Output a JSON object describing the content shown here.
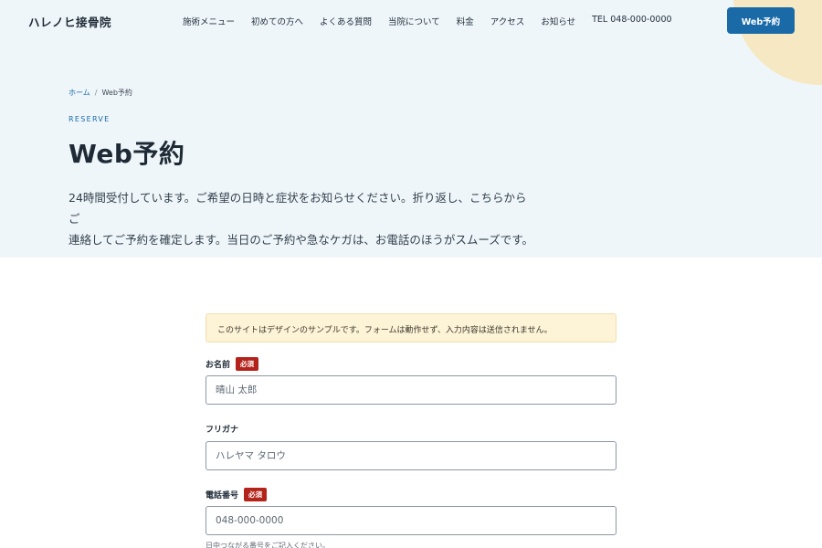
{
  "header": {
    "logo": "ハレノヒ接骨院",
    "nav": [
      {
        "label": "施術メニュー"
      },
      {
        "label": "初めての方へ"
      },
      {
        "label": "よくある質問"
      },
      {
        "label": "当院について"
      },
      {
        "label": "料金"
      },
      {
        "label": "アクセス"
      },
      {
        "label": "お知らせ"
      },
      {
        "label": "TEL 048-000-0000"
      }
    ],
    "cta_label": "Web予約"
  },
  "breadcrumb": {
    "home": "ホーム",
    "separator": "/",
    "current": "Web予約"
  },
  "hero": {
    "eyebrow": "RESERVE",
    "title": "Web予約",
    "lead_line1": "24時間受付しています。ご希望の日時と症状をお知らせください。折り返し、こちらからご",
    "lead_line2": "連絡してご予約を確定します。当日のご予約や急なケガは、お電話のほうがスムーズです。"
  },
  "form": {
    "notice": "このサイトはデザインのサンプルです。フォームは動作せず、入力内容は送信されません。",
    "required_badge": "必須",
    "name": {
      "label": "お名前",
      "placeholder": "晴山 太郎"
    },
    "kana": {
      "label": "フリガナ",
      "placeholder": "ハレヤマ タロウ"
    },
    "phone": {
      "label": "電話番号",
      "placeholder": "048-000-0000",
      "hint": "日中つながる番号をご記入ください。"
    }
  },
  "colors": {
    "accent": "#1a6aa8",
    "hero_bg": "#eff6fa",
    "decor_circle": "#f6e8c3",
    "notice_bg": "#fdf3d7",
    "required": "#b3231c"
  }
}
